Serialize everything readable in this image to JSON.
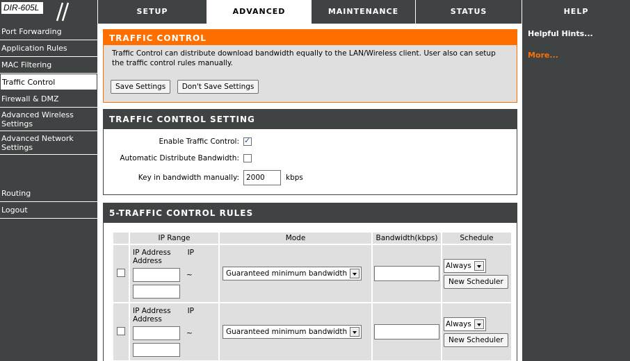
{
  "brand": {
    "model": "DIR-605L"
  },
  "tabs": [
    {
      "label": "SETUP"
    },
    {
      "label": "ADVANCED"
    },
    {
      "label": "MAINTENANCE"
    },
    {
      "label": "STATUS"
    },
    {
      "label": "HELP"
    }
  ],
  "sidebar": {
    "items": [
      {
        "label": "Port Forwarding"
      },
      {
        "label": "Application Rules"
      },
      {
        "label": "MAC Filtering"
      },
      {
        "label": "Traffic Control"
      },
      {
        "label": "Firewall & DMZ"
      },
      {
        "label": "Advanced Wireless Settings"
      },
      {
        "label": "Advanced Network Settings"
      },
      {
        "label": "Routing"
      },
      {
        "label": "Logout"
      }
    ]
  },
  "help": {
    "title": "Helpful Hints...",
    "more": "More..."
  },
  "traffic_control": {
    "title": "TRAFFIC CONTROL",
    "description": "Traffic Control can distribute download bandwidth equally to the LAN/Wireless client. User also can setup the traffic control rules manually.",
    "save_label": "Save Settings",
    "dont_save_label": "Don't Save Settings"
  },
  "setting": {
    "title": "TRAFFIC CONTROL SETTING",
    "enable_label": "Enable Traffic Control:",
    "enable_checked": true,
    "auto_label": "Automatic Distribute Bandwidth:",
    "auto_checked": false,
    "manual_label": "Key in bandwidth manually:",
    "manual_value": "2000",
    "manual_unit": "kbps"
  },
  "rules": {
    "title": "5-TRAFFIC CONTROL RULES",
    "headers": {
      "ip_range": "IP Range",
      "mode": "Mode",
      "bandwidth": "Bandwidth(kbps)",
      "schedule": "Schedule"
    },
    "ip_label_1": "IP Address",
    "ip_label_2": "IP",
    "ip_label_3": "Address",
    "tilde": "~",
    "mode_value": "Guaranteed minimum bandwidth",
    "schedule_value": "Always",
    "new_scheduler_label": "New Scheduler"
  }
}
